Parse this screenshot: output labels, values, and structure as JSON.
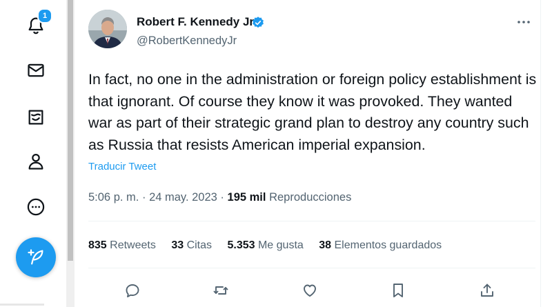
{
  "nav": {
    "notifications_badge": "1",
    "items": [
      {
        "name": "notifications",
        "icon": "bell-icon"
      },
      {
        "name": "messages",
        "icon": "envelope-icon"
      },
      {
        "name": "verified",
        "icon": "verified-square-icon"
      },
      {
        "name": "profile",
        "icon": "person-icon"
      },
      {
        "name": "more",
        "icon": "more-circle-icon"
      }
    ],
    "compose_icon": "feather-plus-icon"
  },
  "tweet": {
    "author_name": "Robert F. Kennedy Jr",
    "handle": "@RobertKennedyJr",
    "text": "In fact, no one in the administration or foreign policy establishment is that ignorant. Of course they know it was provoked. They wanted war as part of their strategic grand plan to destroy any country such as Russia that resists American imperial expansion.",
    "translate_label": "Traducir Tweet",
    "time": "5:06 p. m.",
    "separator": "·",
    "date": "24 may. 2023",
    "views_count": "195 mil",
    "views_label": "Reproducciones",
    "stats": {
      "retweets_count": "835",
      "retweets_label": "Retweets",
      "quotes_count": "33",
      "quotes_label": "Citas",
      "likes_count": "5.353",
      "likes_label": "Me gusta",
      "bookmarks_count": "38",
      "bookmarks_label": "Elementos guardados"
    },
    "actions": [
      "reply-icon",
      "retweet-icon",
      "like-icon",
      "bookmark-icon",
      "share-icon"
    ]
  },
  "colors": {
    "accent": "#1d9bf0",
    "text": "#0f1419",
    "secondary_text": "#536471"
  }
}
